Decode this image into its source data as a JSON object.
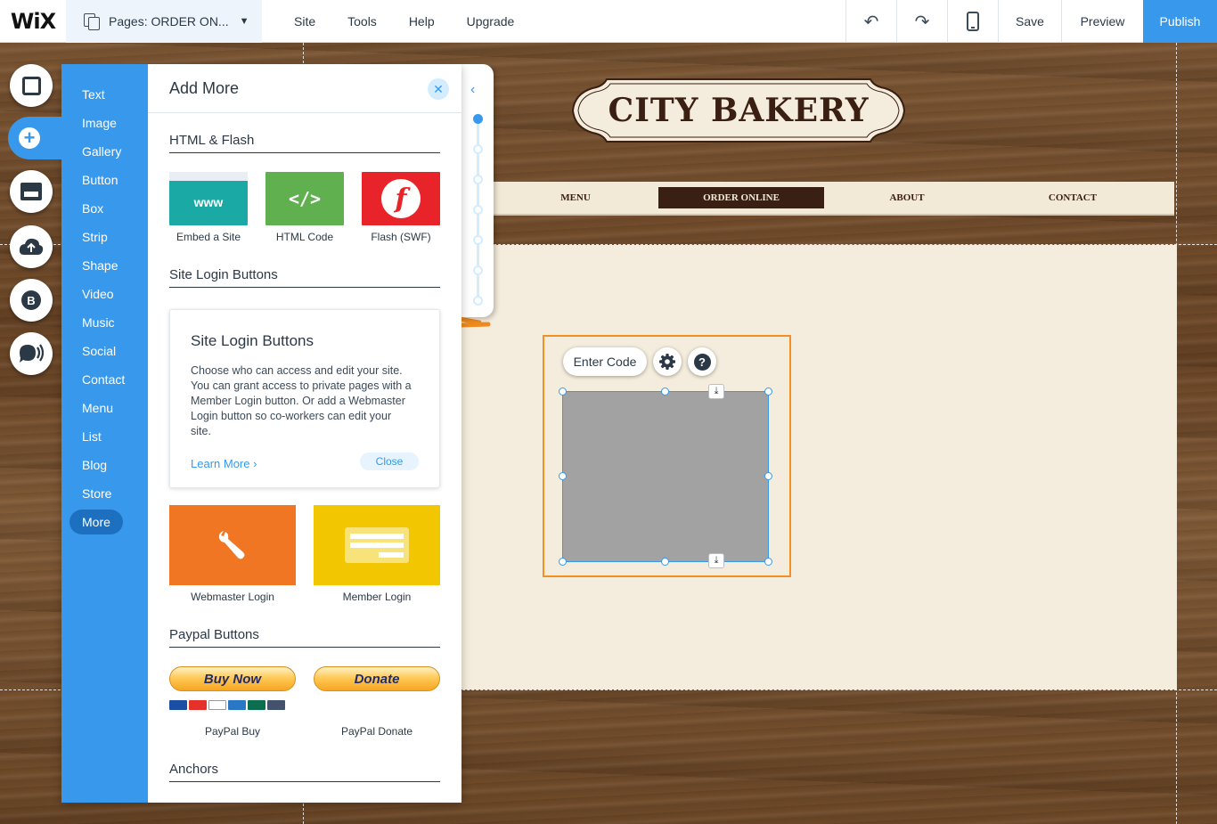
{
  "topbar": {
    "logo": "WiX",
    "pages_label": "Pages: ORDER ON...",
    "chevron_icon": "chevron-down-icon",
    "menu": [
      "Site",
      "Tools",
      "Help",
      "Upgrade"
    ],
    "undo_icon": "undo-icon",
    "redo_icon": "redo-icon",
    "mobile_icon": "mobile-icon",
    "save_label": "Save",
    "preview_label": "Preview",
    "publish_label": "Publish"
  },
  "leftbar": {
    "icons": [
      "background-icon",
      "add-icon",
      "app-market-icon",
      "upload-icon",
      "blog-icon",
      "chat-icon"
    ],
    "blog_letter": "B"
  },
  "add_panel": {
    "categories": [
      "Text",
      "Image",
      "Gallery",
      "Button",
      "Box",
      "Strip",
      "Shape",
      "Video",
      "Music",
      "Social",
      "Contact",
      "Menu",
      "List",
      "Blog",
      "Store",
      "More"
    ],
    "selected_category": "More",
    "title": "Add More",
    "sections": {
      "html_flash": "HTML & Flash",
      "site_login": "Site Login Buttons",
      "paypal": "Paypal Buttons",
      "anchors": "Anchors"
    },
    "tiles": {
      "embed_site": {
        "label": "Embed a Site",
        "glyph": "www"
      },
      "html_code": {
        "label": "HTML Code",
        "glyph": "</>"
      },
      "flash": {
        "label": "Flash (SWF)",
        "glyph": "f"
      }
    },
    "info_card": {
      "title": "Site Login Buttons",
      "body": "Choose who can access and edit your site. You can grant access to private pages with a Member Login button. Or add a Webmaster Login button so co-workers can edit your site.",
      "learn_more": "Learn More ›",
      "close": "Close"
    },
    "login_tiles": {
      "webmaster": "Webmaster Login",
      "member": "Member Login"
    },
    "paypal": {
      "buy_now": "Buy Now",
      "donate": "Donate",
      "buy_caption": "PayPal Buy",
      "donate_caption": "PayPal Donate"
    }
  },
  "site": {
    "title": "CITY BAKERY",
    "nav": [
      "MENU",
      "ORDER ONLINE",
      "ABOUT",
      "CONTACT"
    ],
    "active_nav": "ORDER ONLINE"
  },
  "html_element": {
    "enter_code": "Enter Code",
    "settings_icon": "gear-icon",
    "help_icon": "help-icon",
    "help_glyph": "?"
  },
  "colors": {
    "accent": "#3899ec",
    "selection": "#f29121",
    "embed_tile": "#1aa9a4",
    "html_tile": "#60b04f",
    "flash_tile": "#e8242a",
    "webmaster_tile": "#f07623",
    "member_tile": "#f2c600"
  }
}
